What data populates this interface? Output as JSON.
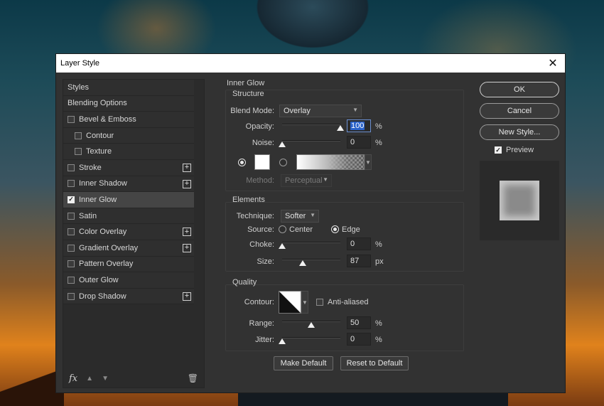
{
  "window": {
    "title": "Layer Style"
  },
  "styles_list": [
    {
      "label": "Styles",
      "checkbox": false,
      "checked": false,
      "indent": false,
      "plus": false,
      "active": false
    },
    {
      "label": "Blending Options",
      "checkbox": false,
      "checked": false,
      "indent": false,
      "plus": false,
      "active": false
    },
    {
      "label": "Bevel & Emboss",
      "checkbox": true,
      "checked": false,
      "indent": false,
      "plus": false,
      "active": false
    },
    {
      "label": "Contour",
      "checkbox": true,
      "checked": false,
      "indent": true,
      "plus": false,
      "active": false
    },
    {
      "label": "Texture",
      "checkbox": true,
      "checked": false,
      "indent": true,
      "plus": false,
      "active": false
    },
    {
      "label": "Stroke",
      "checkbox": true,
      "checked": false,
      "indent": false,
      "plus": true,
      "active": false
    },
    {
      "label": "Inner Shadow",
      "checkbox": true,
      "checked": false,
      "indent": false,
      "plus": true,
      "active": false
    },
    {
      "label": "Inner Glow",
      "checkbox": true,
      "checked": true,
      "indent": false,
      "plus": false,
      "active": true
    },
    {
      "label": "Satin",
      "checkbox": true,
      "checked": false,
      "indent": false,
      "plus": false,
      "active": false
    },
    {
      "label": "Color Overlay",
      "checkbox": true,
      "checked": false,
      "indent": false,
      "plus": true,
      "active": false
    },
    {
      "label": "Gradient Overlay",
      "checkbox": true,
      "checked": false,
      "indent": false,
      "plus": true,
      "active": false
    },
    {
      "label": "Pattern Overlay",
      "checkbox": true,
      "checked": false,
      "indent": false,
      "plus": false,
      "active": false
    },
    {
      "label": "Outer Glow",
      "checkbox": true,
      "checked": false,
      "indent": false,
      "plus": false,
      "active": false
    },
    {
      "label": "Drop Shadow",
      "checkbox": true,
      "checked": false,
      "indent": false,
      "plus": true,
      "active": false
    }
  ],
  "footer": {
    "fx": "fx",
    "trash_icon": "trash-icon",
    "up_icon": "arrow-up-icon",
    "down_icon": "arrow-down-icon"
  },
  "inner_glow": {
    "section_title": "Inner Glow",
    "structure": {
      "title": "Structure",
      "blend_mode_label": "Blend Mode:",
      "blend_mode_value": "Overlay",
      "opacity_label": "Opacity:",
      "opacity_value": "100",
      "opacity_unit": "%",
      "opacity_fraction": 1.0,
      "noise_label": "Noise:",
      "noise_value": "0",
      "noise_unit": "%",
      "noise_fraction": 0.0,
      "solid_color_selected": true,
      "glow_color": "#ffffff",
      "method_label": "Method:",
      "method_value": "Perceptual"
    },
    "elements": {
      "title": "Elements",
      "technique_label": "Technique:",
      "technique_value": "Softer",
      "source_label": "Source:",
      "source_center": "Center",
      "source_edge": "Edge",
      "source_selected": "Edge",
      "choke_label": "Choke:",
      "choke_value": "0",
      "choke_unit": "%",
      "choke_fraction": 0.0,
      "size_label": "Size:",
      "size_value": "87",
      "size_unit": "px",
      "size_fraction": 0.35
    },
    "quality": {
      "title": "Quality",
      "contour_label": "Contour:",
      "anti_aliased_label": "Anti-aliased",
      "anti_aliased": false,
      "range_label": "Range:",
      "range_value": "50",
      "range_unit": "%",
      "range_fraction": 0.5,
      "jitter_label": "Jitter:",
      "jitter_value": "0",
      "jitter_unit": "%",
      "jitter_fraction": 0.0
    },
    "make_default": "Make Default",
    "reset_default": "Reset to Default"
  },
  "right": {
    "ok": "OK",
    "cancel": "Cancel",
    "new_style": "New Style...",
    "preview_label": "Preview",
    "preview_checked": true
  }
}
